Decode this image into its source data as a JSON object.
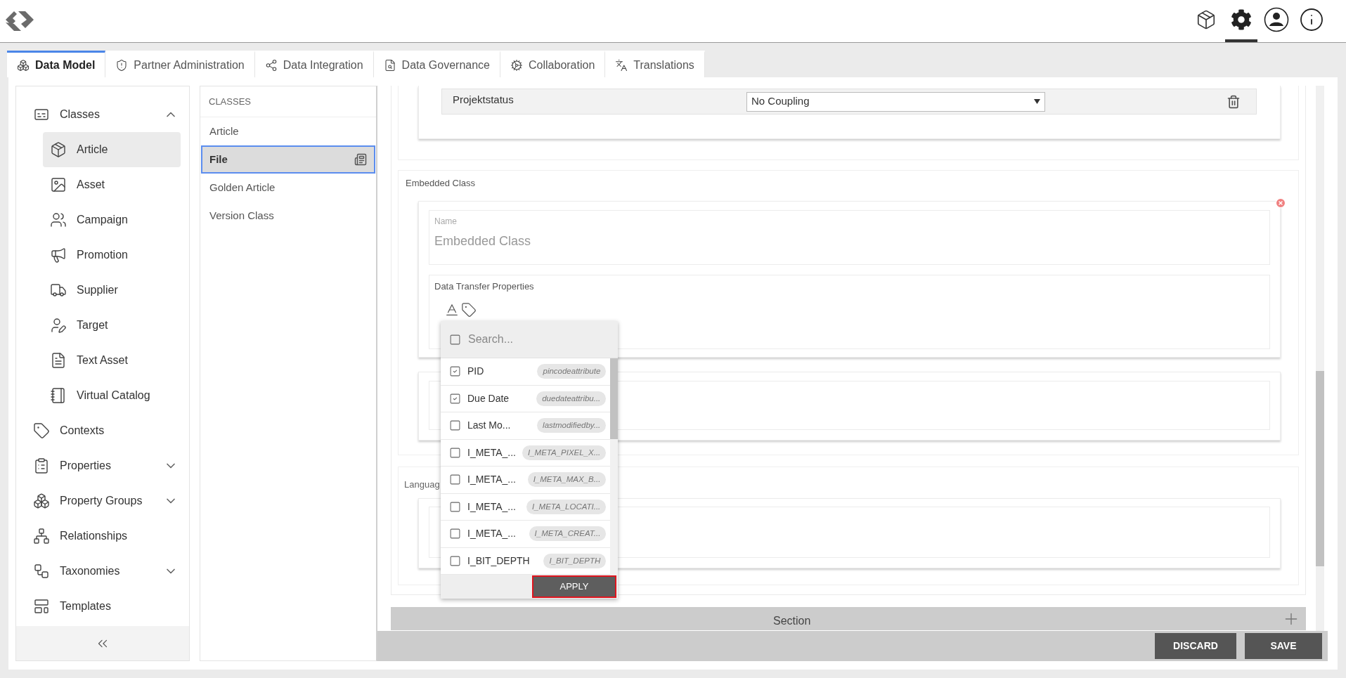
{
  "header_tools": [
    {
      "kind": "box",
      "selected": false
    },
    {
      "kind": "settings",
      "selected": true
    },
    {
      "kind": "user",
      "selected": false
    },
    {
      "kind": "info",
      "selected": false
    }
  ],
  "tabs": [
    {
      "label": "Data Model",
      "kind": "data_model",
      "selected": true
    },
    {
      "label": "Partner Administration",
      "kind": "partner",
      "selected": false
    },
    {
      "label": "Data Integration",
      "kind": "integration",
      "selected": false
    },
    {
      "label": "Data Governance",
      "kind": "governance",
      "selected": false
    },
    {
      "label": "Collaboration",
      "kind": "collaboration",
      "selected": false
    },
    {
      "label": "Translations",
      "kind": "translations",
      "selected": false
    }
  ],
  "sidebar": {
    "items": [
      {
        "label": "Classes",
        "kind": "classes",
        "expanded": true,
        "children": [
          {
            "label": "Article",
            "kind": "article",
            "selected": true
          },
          {
            "label": "Asset",
            "kind": "asset",
            "selected": false
          },
          {
            "label": "Campaign",
            "kind": "campaign",
            "selected": false
          },
          {
            "label": "Promotion",
            "kind": "promotion",
            "selected": false
          },
          {
            "label": "Supplier",
            "kind": "supplier",
            "selected": false
          },
          {
            "label": "Target",
            "kind": "target",
            "selected": false
          },
          {
            "label": "Text Asset",
            "kind": "text_asset",
            "selected": false
          },
          {
            "label": "Virtual Catalog",
            "kind": "virtual_catalog",
            "selected": false
          }
        ]
      },
      {
        "label": "Contexts",
        "kind": "contexts"
      },
      {
        "label": "Properties",
        "kind": "properties",
        "expanded": false
      },
      {
        "label": "Property Groups",
        "kind": "property_groups",
        "expanded": false
      },
      {
        "label": "Relationships",
        "kind": "relationships"
      },
      {
        "label": "Taxonomies",
        "kind": "taxonomies",
        "expanded": false
      },
      {
        "label": "Templates",
        "kind": "templates"
      }
    ]
  },
  "classes_list": {
    "header": "CLASSES",
    "items": [
      {
        "label": "Article",
        "selected": false
      },
      {
        "label": "File",
        "selected": true
      },
      {
        "label": "Golden Article",
        "selected": false
      },
      {
        "label": "Version Class",
        "selected": false
      }
    ]
  },
  "editor": {
    "coupling_row": {
      "label": "Projektstatus",
      "value": "No Coupling"
    },
    "embedded_class": {
      "title": "Embedded Class",
      "name_label": "Name",
      "name_value": "Embedded Class",
      "transfer_label": "Data Transfer Properties"
    },
    "language_section": {
      "title": "Languag"
    },
    "section_bar": {
      "label": "Section"
    }
  },
  "dropdown": {
    "search_placeholder": "Search...",
    "select_all_checked": false,
    "items": [
      {
        "label": "PID",
        "tag": "pincodeattribute",
        "checked": true
      },
      {
        "label": "Due Date",
        "tag": "duedateattribu...",
        "checked": true
      },
      {
        "label": "Last Mo...",
        "tag": "lastmodifiedby...",
        "checked": false
      },
      {
        "label": "I_META_...",
        "tag": "I_META_PIXEL_X...",
        "checked": false
      },
      {
        "label": "I_META_...",
        "tag": "I_META_MAX_B...",
        "checked": false
      },
      {
        "label": "I_META_...",
        "tag": "I_META_LOCATI...",
        "checked": false
      },
      {
        "label": "I_META_...",
        "tag": "I_META_CREAT...",
        "checked": false
      },
      {
        "label": "I_BIT_DEPTH",
        "tag": "I_BIT_DEPTH",
        "checked": false
      }
    ],
    "apply": "APPLY"
  },
  "actions": [
    {
      "label": "DISCARD"
    },
    {
      "label": "SAVE"
    }
  ]
}
